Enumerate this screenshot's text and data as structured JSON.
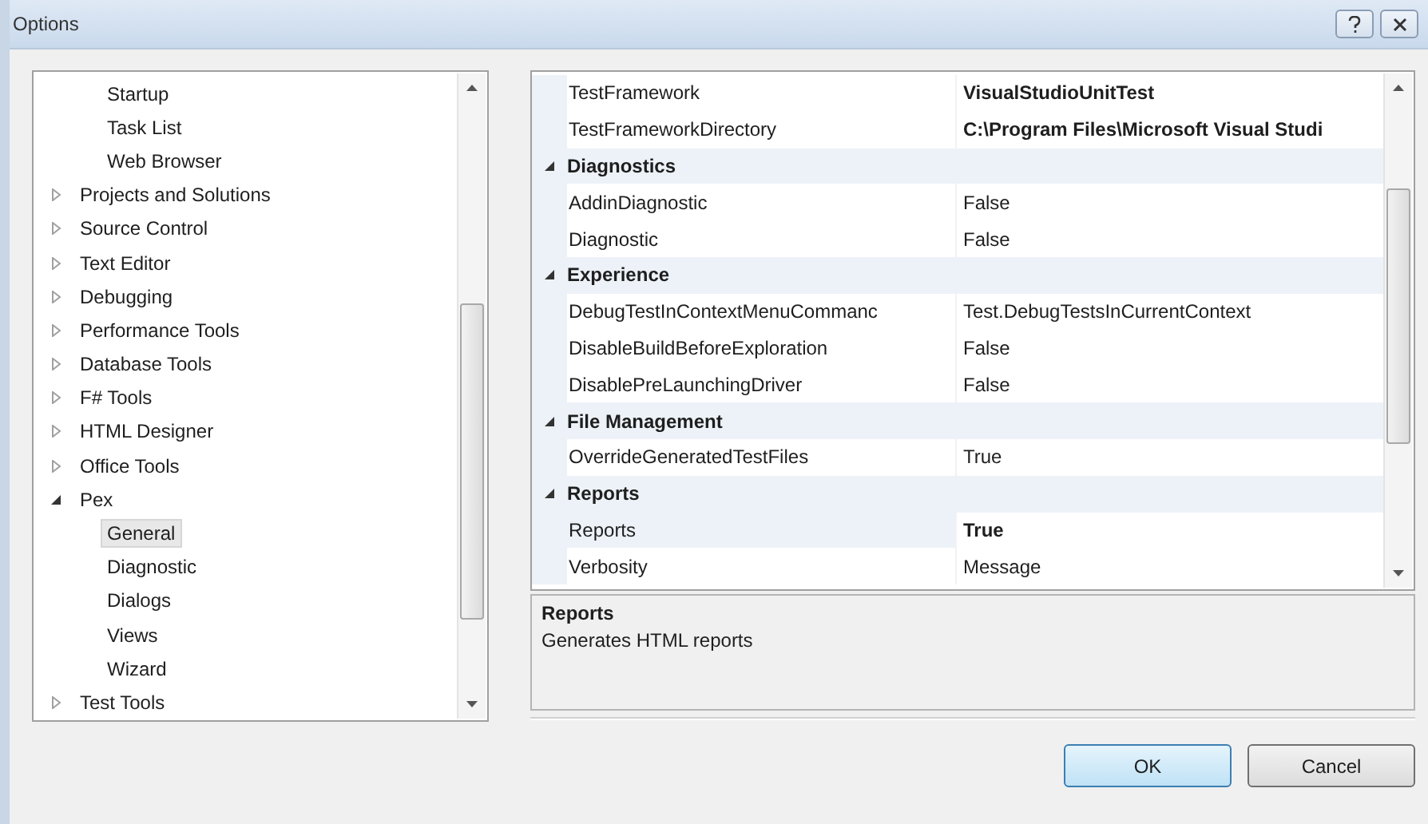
{
  "window": {
    "title": "Options"
  },
  "tree": {
    "items": [
      {
        "children": [
          {
            "label": "Startup",
            "selected": false
          },
          {
            "label": "Task List",
            "selected": false
          },
          {
            "label": "Web Browser",
            "selected": false
          }
        ]
      },
      {
        "label": "Projects and Solutions",
        "expanded": false,
        "selected": false
      },
      {
        "label": "Source Control",
        "expanded": false,
        "selected": false
      },
      {
        "label": "Text Editor",
        "expanded": false,
        "selected": false
      },
      {
        "label": "Debugging",
        "expanded": false,
        "selected": false
      },
      {
        "label": "Performance Tools",
        "expanded": false,
        "selected": false
      },
      {
        "label": "Database Tools",
        "expanded": false,
        "selected": false
      },
      {
        "label": "F# Tools",
        "expanded": false,
        "selected": false
      },
      {
        "label": "HTML Designer",
        "expanded": false,
        "selected": false
      },
      {
        "label": "Office Tools",
        "expanded": false,
        "selected": false
      },
      {
        "label": "Pex",
        "expanded": true,
        "selected": false,
        "children": [
          {
            "label": "General",
            "selected": true
          },
          {
            "label": "Diagnostic",
            "selected": false
          },
          {
            "label": "Dialogs",
            "selected": false
          },
          {
            "label": "Views",
            "selected": false
          },
          {
            "label": "Wizard",
            "selected": false
          }
        ]
      },
      {
        "label": "Test Tools",
        "expanded": false,
        "selected": false
      }
    ]
  },
  "properties": {
    "groups": [
      {
        "properties": [
          {
            "name": "TestFramework",
            "value": "VisualStudioUnitTest",
            "modified": true,
            "selected": false
          },
          {
            "name": "TestFrameworkDirectory",
            "value": "C:\\Program Files\\Microsoft Visual Studi",
            "modified": true,
            "selected": false
          }
        ]
      },
      {
        "category": "Diagnostics",
        "expanded": true,
        "properties": [
          {
            "name": "AddinDiagnostic",
            "value": "False",
            "modified": false,
            "selected": false
          },
          {
            "name": "Diagnostic",
            "value": "False",
            "modified": false,
            "selected": false
          }
        ]
      },
      {
        "category": "Experience",
        "expanded": true,
        "properties": [
          {
            "name": "DebugTestInContextMenuCommanc",
            "value": "Test.DebugTestsInCurrentContext",
            "modified": false,
            "selected": false
          },
          {
            "name": "DisableBuildBeforeExploration",
            "value": "False",
            "modified": false,
            "selected": false
          },
          {
            "name": "DisablePreLaunchingDriver",
            "value": "False",
            "modified": false,
            "selected": false
          }
        ]
      },
      {
        "category": "File Management",
        "expanded": true,
        "properties": [
          {
            "name": "OverrideGeneratedTestFiles",
            "value": "True",
            "modified": false,
            "selected": false
          }
        ]
      },
      {
        "category": "Reports",
        "expanded": true,
        "properties": [
          {
            "name": "Reports",
            "value": "True",
            "modified": true,
            "selected": true
          },
          {
            "name": "Verbosity",
            "value": "Message",
            "modified": false,
            "selected": false
          }
        ]
      }
    ]
  },
  "description": {
    "title": "Reports",
    "text": "Generates HTML reports"
  },
  "buttons": [
    {
      "label": "OK",
      "default": true
    },
    {
      "label": "Cancel",
      "default": false
    }
  ]
}
